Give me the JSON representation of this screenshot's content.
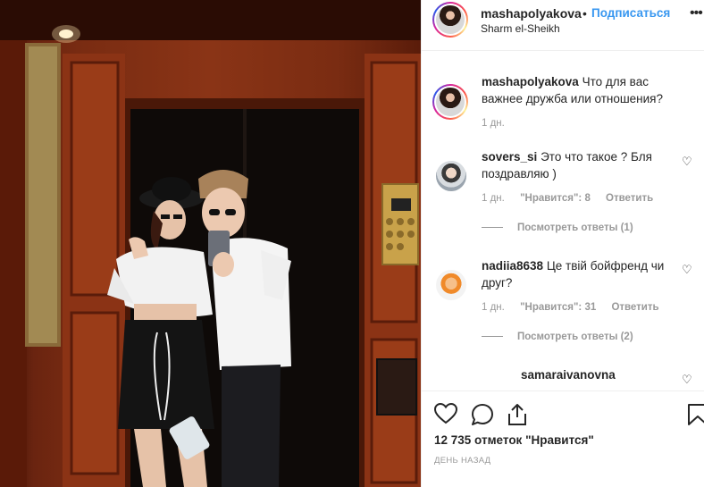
{
  "post": {
    "username": "mashapolyakova",
    "separator": "•",
    "follow_label": "Подписаться",
    "location": "Sharm el-Sheikh",
    "more_icon": "ellipsis-icon",
    "caption_user": "mashapolyakova",
    "caption_text": "Что для вас важнее дружба или отношения?",
    "caption_time": "1 дн."
  },
  "comments": [
    {
      "user": "sovers_si",
      "text": "Это что такое ? Бля поздравляю )",
      "time": "1 дн.",
      "likes_label": "\"Нравится\": 8",
      "reply_label": "Ответить",
      "view_replies": "Посмотреть ответы (1)"
    },
    {
      "user": "nadiia8638",
      "text": "Це твій бойфренд чи друг?",
      "time": "1 дн.",
      "likes_label": "\"Нравится\": 31",
      "reply_label": "Ответить",
      "view_replies": "Посмотреть ответы (2)"
    },
    {
      "user": "samaraivanovna",
      "text": ""
    }
  ],
  "actions": {
    "likes_text": "12 735 отметок \"Нравится\"",
    "time_text": "ДЕНЬ НАЗАД"
  },
  "colors": {
    "accent": "#3897f0",
    "text": "#262626",
    "muted": "#999999"
  }
}
